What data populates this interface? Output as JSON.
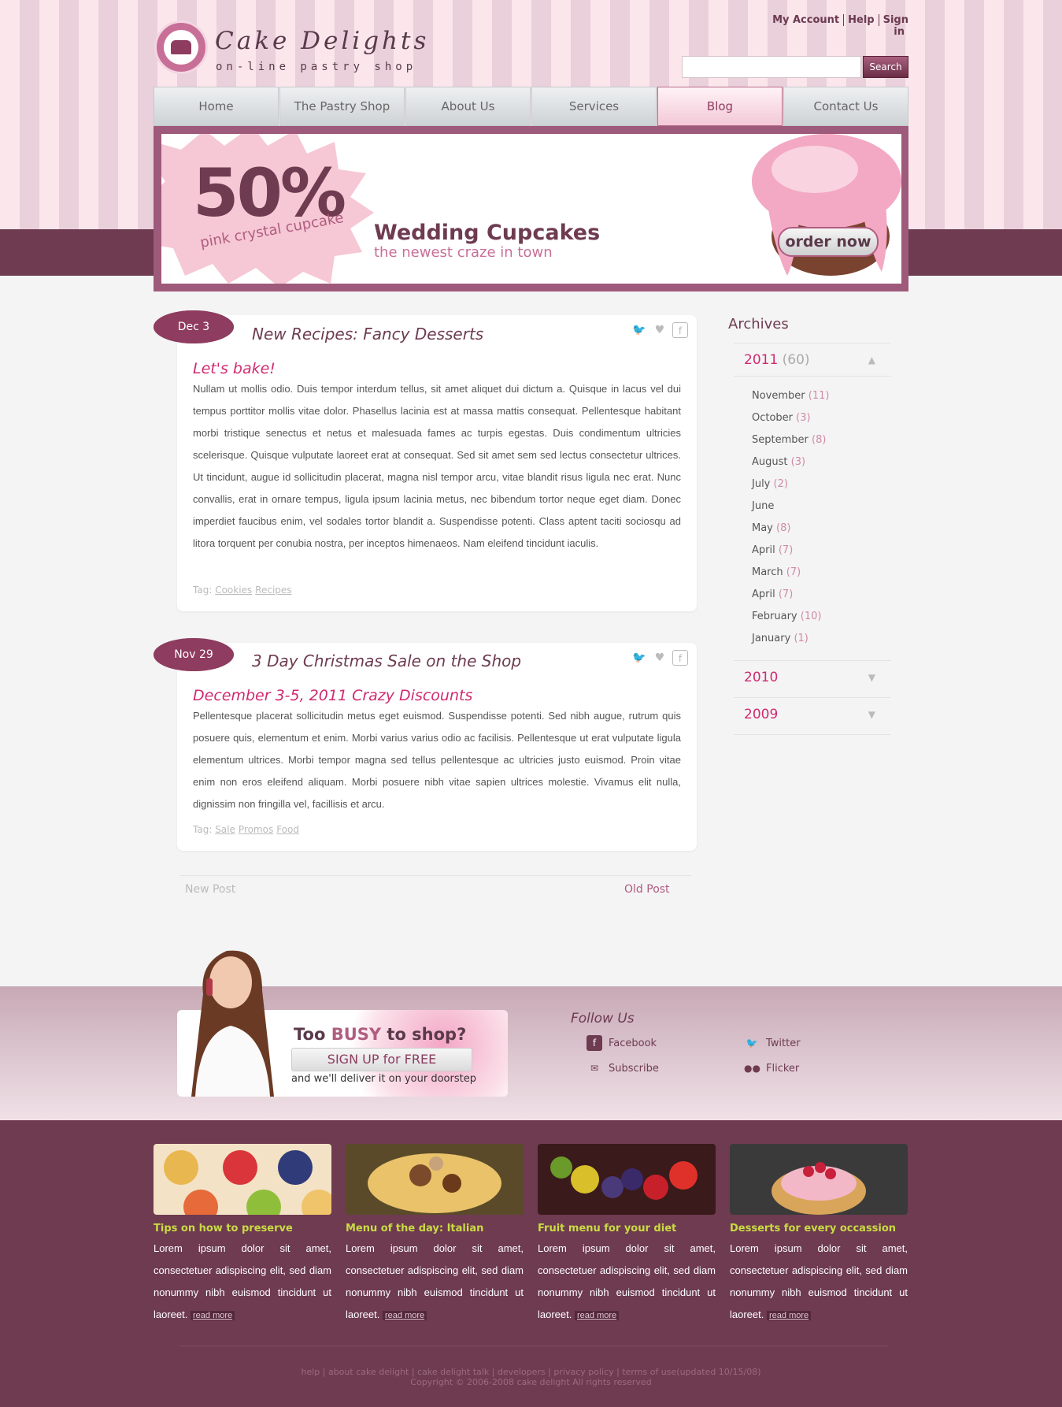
{
  "brand": {
    "title": "Cake Delights",
    "subtitle": "on-line pastry shop"
  },
  "top_links": [
    "My Account",
    "Help",
    "Sign in"
  ],
  "search": {
    "placeholder": "",
    "button": "Search"
  },
  "nav": [
    {
      "label": "Home"
    },
    {
      "label": "The Pastry Shop"
    },
    {
      "label": "About Us"
    },
    {
      "label": "Services"
    },
    {
      "label": "Blog",
      "active": true
    },
    {
      "label": "Contact Us"
    }
  ],
  "banner": {
    "discount": "50%",
    "discount_label": "pink crystal cupcake",
    "title": "Wedding Cupcakes",
    "tagline": "the newest craze in town",
    "cta": "order now"
  },
  "posts": [
    {
      "date": "Dec 3",
      "title": "New Recipes: Fancy Desserts",
      "subtitle": "Let's bake!",
      "body": "Nullam ut mollis odio. Duis tempor interdum tellus, sit amet aliquet dui dictum a. Quisque in lacus vel dui tempus porttitor mollis vitae dolor. Phasellus lacinia est at massa mattis consequat. Pellentesque habitant morbi tristique senectus et netus et malesuada fames ac turpis egestas. Duis condimentum ultricies scelerisque. Quisque vulputate laoreet erat at consequat. Sed sit amet sem sed lectus consectetur ultrices. Ut tincidunt, augue id sollicitudin placerat, magna nisl tempor arcu, vitae blandit risus ligula nec erat. Nunc convallis, erat in ornare tempus, ligula ipsum lacinia metus, nec bibendum tortor neque eget diam. Donec imperdiet faucibus enim, vel sodales tortor blandit a. Suspendisse potenti. Class aptent taciti sociosqu ad litora torquent per conubia nostra, per inceptos himenaeos. Nam eleifend tincidunt iaculis.",
      "tag_label": "Tag:",
      "tags": [
        "Cookies",
        "Recipes"
      ]
    },
    {
      "date": "Nov 29",
      "title": "3 Day Christmas Sale on the Shop",
      "subtitle": "December 3-5, 2011 Crazy Discounts",
      "body": "Pellentesque placerat sollicitudin metus eget euismod. Suspendisse potenti. Sed nibh augue, rutrum quis posuere quis, elementum et enim. Morbi varius varius odio ac facilisis. Pellentesque ut erat vulputate ligula elementum ultrices. Morbi tempor magna sed tellus pellentesque ac ultricies justo euismod. Proin vitae enim non eros eleifend aliquam. Morbi posuere nibh vitae sapien ultrices molestie. Vivamus elit nulla, dignissim non fringilla vel, facillisis et arcu.",
      "tag_label": "Tag:",
      "tags": [
        "Sale",
        "Promos",
        "Food"
      ]
    }
  ],
  "pager": {
    "new": "New Post",
    "old": "Old Post"
  },
  "archives": {
    "title": "Archives",
    "years": [
      {
        "year": "2011",
        "count": "(60)",
        "expanded": true
      },
      {
        "year": "2010",
        "count": ""
      },
      {
        "year": "2009",
        "count": ""
      }
    ],
    "months": [
      {
        "name": "November",
        "count": "(11)"
      },
      {
        "name": "October",
        "count": "(3)"
      },
      {
        "name": "September",
        "count": "(8)"
      },
      {
        "name": "August",
        "count": "(3)"
      },
      {
        "name": "July",
        "count": "(2)"
      },
      {
        "name": "June",
        "count": ""
      },
      {
        "name": "May",
        "count": "(8)"
      },
      {
        "name": "April",
        "count": "(7)"
      },
      {
        "name": "March",
        "count": "(7)"
      },
      {
        "name": "April",
        "count": "(7)"
      },
      {
        "name": "February",
        "count": "(10)"
      },
      {
        "name": "January",
        "count": "(1)"
      }
    ]
  },
  "promo": {
    "title_pre": "Too ",
    "title_em": "BUSY",
    "title_post": " to shop?",
    "button": "SIGN UP for FREE",
    "deliver": "and we'll deliver it on your doorstep"
  },
  "follow": {
    "title": "Follow Us",
    "items": [
      {
        "label": "Facebook",
        "icon": "facebook-icon"
      },
      {
        "label": "Twitter",
        "icon": "twitter-icon"
      },
      {
        "label": "Subscribe",
        "icon": "mail-icon"
      },
      {
        "label": "Flicker",
        "icon": "flickr-icon"
      }
    ]
  },
  "footer_cols": [
    {
      "heading": "Tips on how to preserve",
      "body": "Lorem ipsum dolor sit amet, consectetuer adispiscing elit, sed diam nonummy nibh euismod tincidunt ut laoreet.",
      "more": "read more"
    },
    {
      "heading": "Menu of the day: Italian",
      "body": "Lorem ipsum dolor sit amet, consectetuer adispiscing elit, sed diam nonummy nibh euismod tincidunt ut laoreet.",
      "more": "read more"
    },
    {
      "heading": "Fruit menu for your diet",
      "body": "Lorem ipsum dolor sit amet, consectetuer adispiscing elit, sed diam nonummy nibh euismod tincidunt ut laoreet.",
      "more": "read more"
    },
    {
      "heading": "Desserts for every occassion",
      "body": "Lorem ipsum dolor sit amet, consectetuer adispiscing elit, sed diam nonummy nibh euismod tincidunt ut laoreet.",
      "more": "read more"
    }
  ],
  "footer": {
    "links": "help | about cake delight | cake delight talk | developers | privacy policy | terms of use(updated 10/15/08)",
    "copyright": "Copyright © 2006-2008 cake delight All rights reserved"
  },
  "colors": {
    "brand": "#6e3b50",
    "accent": "#d02a70",
    "footer_heading": "#c9db43"
  }
}
